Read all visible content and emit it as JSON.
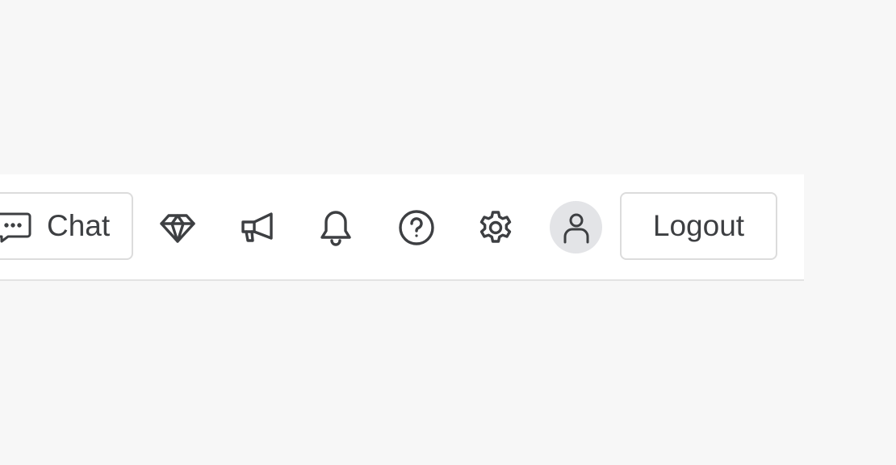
{
  "toolbar": {
    "chat_label": "Chat",
    "logout_label": "Logout",
    "icons": [
      "chat-icon",
      "diamond-icon",
      "megaphone-icon",
      "bell-icon",
      "help-icon",
      "gear-icon",
      "user-icon"
    ]
  },
  "colors": {
    "background": "#f7f7f7",
    "toolbar_bg": "#ffffff",
    "icon": "#3d3f42",
    "border": "#dcdcdc",
    "avatar_bg": "#e3e4e7"
  }
}
